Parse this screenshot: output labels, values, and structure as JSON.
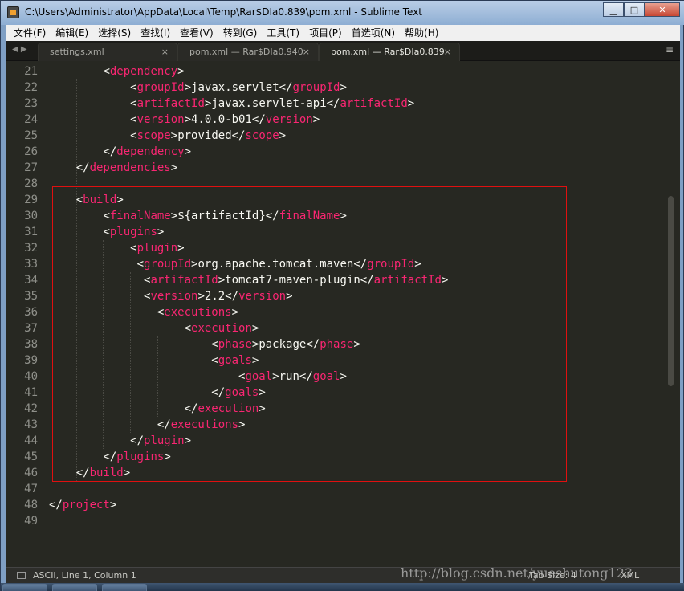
{
  "window": {
    "title": "C:\\Users\\Administrator\\AppData\\Local\\Temp\\Rar$DIa0.839\\pom.xml - Sublime Text",
    "minimize_glyph": "▁",
    "maximize_glyph": "□",
    "close_glyph": "✕"
  },
  "menu": [
    "文件(F)",
    "编辑(E)",
    "选择(S)",
    "查找(I)",
    "查看(V)",
    "转到(G)",
    "工具(T)",
    "项目(P)",
    "首选项(N)",
    "帮助(H)"
  ],
  "tabs": [
    {
      "label": "settings.xml",
      "active": false
    },
    {
      "label": "pom.xml — Rar$DIa0.940",
      "active": false
    },
    {
      "label": "pom.xml — Rar$DIa0.839",
      "active": true
    }
  ],
  "tab_close_glyph": "×",
  "nav_arrows": "◀ ▶",
  "tab_menu_glyph": "≡",
  "code_lines": [
    {
      "n": "21",
      "text": "        <dependency>"
    },
    {
      "n": "22",
      "text": "            <groupId>javax.servlet</groupId>"
    },
    {
      "n": "23",
      "text": "            <artifactId>javax.servlet-api</artifactId>"
    },
    {
      "n": "24",
      "text": "            <version>4.0.0-b01</version>"
    },
    {
      "n": "25",
      "text": "            <scope>provided</scope>"
    },
    {
      "n": "26",
      "text": "        </dependency>"
    },
    {
      "n": "27",
      "text": "    </dependencies>"
    },
    {
      "n": "28",
      "text": ""
    },
    {
      "n": "29",
      "text": "    <build>"
    },
    {
      "n": "30",
      "text": "        <finalName>${artifactId}</finalName>"
    },
    {
      "n": "31",
      "text": "        <plugins>"
    },
    {
      "n": "32",
      "text": "            <plugin>"
    },
    {
      "n": "33",
      "text": "             <groupId>org.apache.tomcat.maven</groupId>"
    },
    {
      "n": "34",
      "text": "              <artifactId>tomcat7-maven-plugin</artifactId>"
    },
    {
      "n": "35",
      "text": "              <version>2.2</version>"
    },
    {
      "n": "36",
      "text": "                <executions>"
    },
    {
      "n": "37",
      "text": "                    <execution>"
    },
    {
      "n": "38",
      "text": "                        <phase>package</phase>"
    },
    {
      "n": "39",
      "text": "                        <goals>"
    },
    {
      "n": "40",
      "text": "                            <goal>run</goal>"
    },
    {
      "n": "41",
      "text": "                        </goals>"
    },
    {
      "n": "42",
      "text": "                    </execution>"
    },
    {
      "n": "43",
      "text": "                </executions>"
    },
    {
      "n": "44",
      "text": "            </plugin>"
    },
    {
      "n": "45",
      "text": "        </plugins>"
    },
    {
      "n": "46",
      "text": "    </build>"
    },
    {
      "n": "47",
      "text": ""
    },
    {
      "n": "48",
      "text": "</project>"
    },
    {
      "n": "49",
      "text": ""
    }
  ],
  "status": {
    "text": "ASCII, Line 1, Column 1",
    "tab_size": "Tab Size: 4",
    "syntax": "XML"
  },
  "watermark": "http://blog.csdn.net/yueshutong123",
  "colors": {
    "tag": "#f92672",
    "punct": "#f8f8f2",
    "bg": "#272822",
    "highlight_box": "#e01010"
  }
}
